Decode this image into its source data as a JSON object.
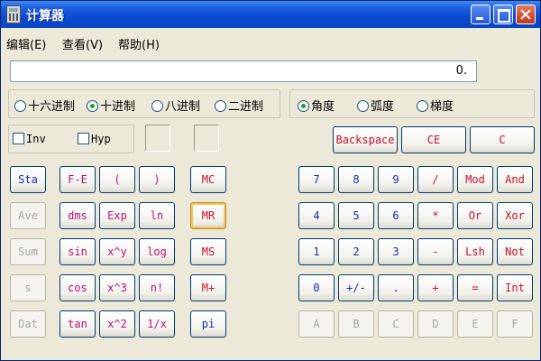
{
  "window": {
    "title": "计算器"
  },
  "menu": [
    "编辑(E)",
    "查看(V)",
    "帮助(H)"
  ],
  "display": {
    "value": "0."
  },
  "base_modes": [
    {
      "label": "十六进制",
      "selected": false
    },
    {
      "label": "十进制",
      "selected": true
    },
    {
      "label": "八进制",
      "selected": false
    },
    {
      "label": "二进制",
      "selected": false
    }
  ],
  "angle_modes": [
    {
      "label": "角度",
      "selected": true
    },
    {
      "label": "弧度",
      "selected": false
    },
    {
      "label": "梯度",
      "selected": false
    }
  ],
  "checkboxes": [
    {
      "label": "Inv",
      "checked": false
    },
    {
      "label": "Hyp",
      "checked": false
    }
  ],
  "edit_buttons": {
    "backspace": "Backspace",
    "ce": "CE",
    "c": "C"
  },
  "stat_buttons": [
    "Sta",
    "Ave",
    "Sum",
    "s",
    "Dat"
  ],
  "func_col1": [
    "F-E",
    "dms",
    "sin",
    "cos",
    "tan"
  ],
  "func_col2": [
    "(",
    "Exp",
    "x^y",
    "x^3",
    "x^2"
  ],
  "func_col3": [
    ")",
    "ln",
    "log",
    "n!",
    "1/x"
  ],
  "memory_buttons": [
    "MC",
    "MR",
    "MS",
    "M+",
    "pi"
  ],
  "keypad": [
    [
      "7",
      "8",
      "9",
      "/",
      "Mod",
      "And"
    ],
    [
      "4",
      "5",
      "6",
      "*",
      "Or",
      "Xor"
    ],
    [
      "1",
      "2",
      "3",
      "-",
      "Lsh",
      "Not"
    ],
    [
      "0",
      "+/-",
      ".",
      "+",
      "=",
      "Int"
    ],
    [
      "A",
      "B",
      "C",
      "D",
      "E",
      "F"
    ]
  ],
  "colors": {
    "titlebar": "#0a4ad0",
    "blue_text": "#1a2fa8",
    "red_text": "#c8102e",
    "pink_text": "#c0107a",
    "disabled_text": "#a8a8a0"
  }
}
